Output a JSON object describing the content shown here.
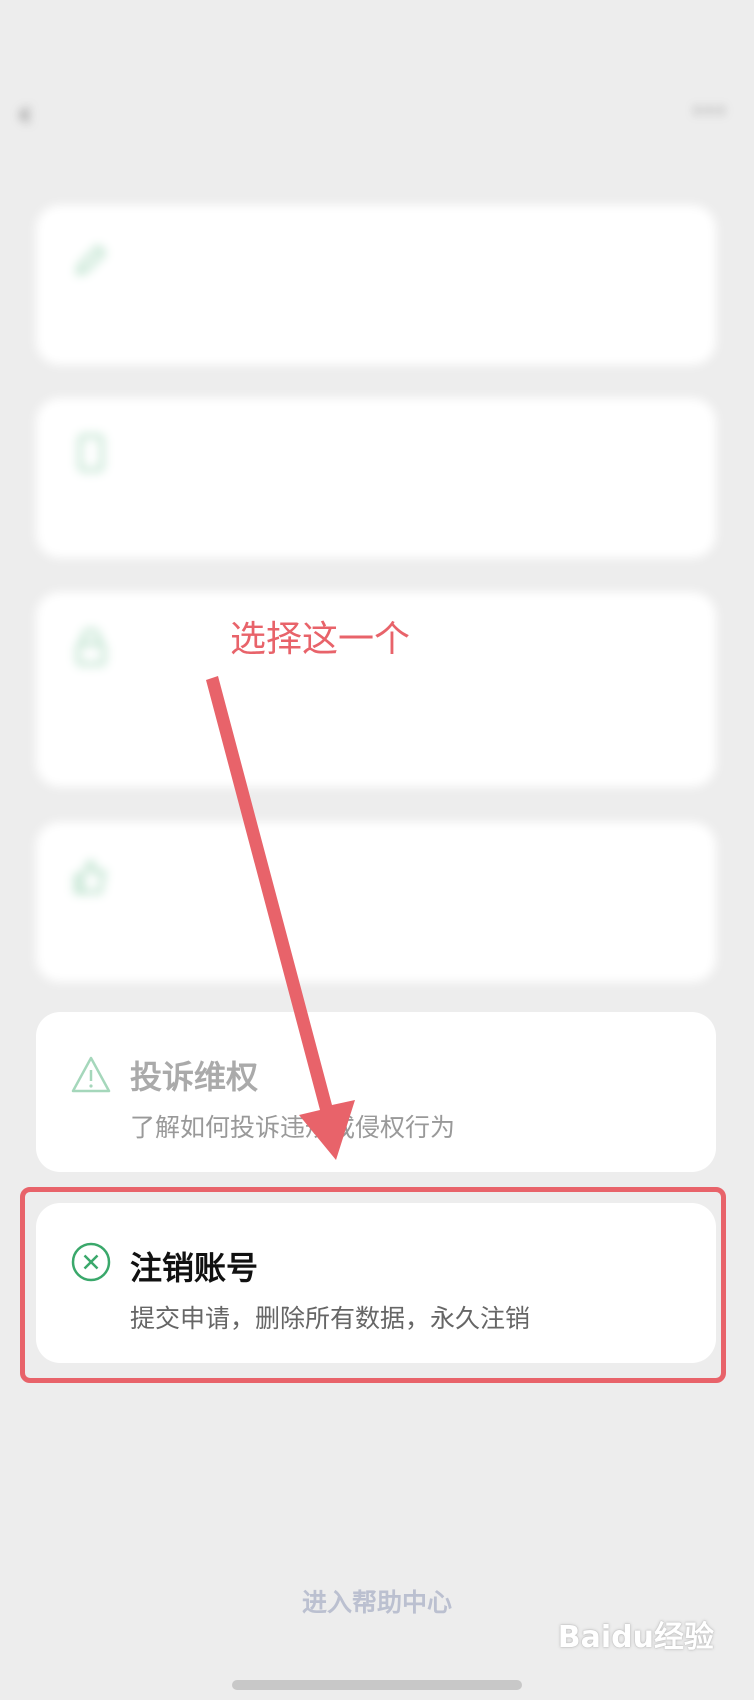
{
  "status_bar": {
    "left": "",
    "right": ""
  },
  "nav": {
    "title": "",
    "back_icon": "back-icon",
    "more_icon": "more-icon"
  },
  "cards": [
    {
      "title": "",
      "desc": "",
      "icon": "pencil-icon"
    },
    {
      "title": "",
      "desc": "",
      "icon": "phone-icon"
    },
    {
      "title": "",
      "desc": "",
      "icon": "lock-icon"
    },
    {
      "title": "",
      "desc": "",
      "icon": "thumbs-up-icon"
    },
    {
      "title": "投诉维权",
      "desc": "了解如何投诉违规或侵权行为",
      "icon": "warning-triangle-icon"
    },
    {
      "title": "注销账号",
      "desc": "提交申请，删除所有数据，永久注销",
      "icon": "close-circle-icon"
    }
  ],
  "annotation": {
    "text": "选择这一个",
    "color": "#e8636a"
  },
  "help_link": "进入帮助中心",
  "watermark": "Baidu经验",
  "colors": {
    "accent_green": "#3aa86b",
    "annotation_red": "#e8636a",
    "background": "#ededed"
  }
}
